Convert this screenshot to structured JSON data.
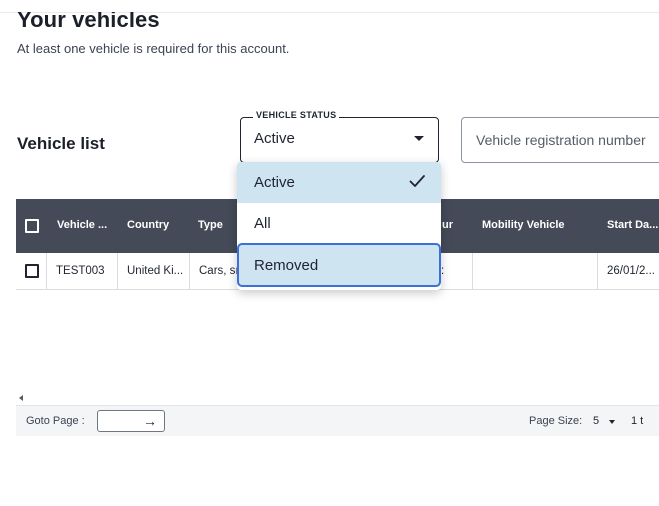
{
  "page": {
    "title": "Your vehicles",
    "subtitle": "At least one vehicle is required for this account."
  },
  "vehicle_list": {
    "title": "Vehicle list",
    "status_filter": {
      "legend": "VEHICLE STATUS",
      "value": "Active",
      "options": [
        {
          "label": "Active",
          "selected": true
        },
        {
          "label": "All",
          "selected": false
        },
        {
          "label": "Removed",
          "selected": false,
          "focused": true
        }
      ]
    },
    "registration_search": {
      "placeholder": "Vehicle registration number"
    }
  },
  "table": {
    "columns": [
      "Vehicle ...",
      "Country",
      "Type",
      "ur",
      "Mobility Vehicle",
      "Start Da..."
    ],
    "rows": [
      {
        "vehicle": "TEST003",
        "country": "United Ki...",
        "type": "Cars, sı",
        "colour_fragment": ":",
        "mobility": "",
        "start_date": "26/01/2..."
      }
    ]
  },
  "pager": {
    "goto_label": "Goto Page :",
    "page_size_label": "Page Size:",
    "page_size_value": "5",
    "range_text": "1 t"
  },
  "colors": {
    "header_bg": "#444a58",
    "option_highlight": "#cfe4f1",
    "focus_ring": "#3d6fd8"
  }
}
